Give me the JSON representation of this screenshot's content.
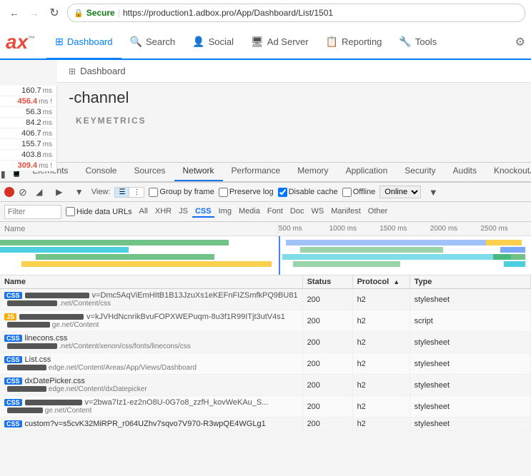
{
  "browser": {
    "url_secure": "Secure",
    "url": "https://production1.adbox.pro/App/Dashboard/List/1501",
    "back_disabled": false,
    "forward_disabled": true
  },
  "nav": {
    "logo": "ax",
    "logo_sup": "™",
    "items": [
      {
        "id": "dashboard",
        "label": "Dashboard",
        "icon": "⊞",
        "active": true
      },
      {
        "id": "search",
        "label": "Search",
        "icon": "🔍"
      },
      {
        "id": "social",
        "label": "Social",
        "icon": "👤"
      },
      {
        "id": "adserver",
        "label": "Ad Server",
        "icon": "🖥"
      },
      {
        "id": "reporting",
        "label": "Reporting",
        "icon": "📋"
      },
      {
        "id": "tools",
        "label": "Tools",
        "icon": "🔧"
      }
    ],
    "settings_icon": "⚙"
  },
  "breadcrumb": {
    "icon": "⊞",
    "text": "Dashboard"
  },
  "page": {
    "title": "-channel",
    "subtitle": "KEYMETRICS"
  },
  "metrics": [
    {
      "value": "160.7",
      "unit": "ms",
      "alert": false
    },
    {
      "value": "456.4",
      "unit": "ms !",
      "alert": true
    },
    {
      "value": "56.3",
      "unit": "ms",
      "alert": false
    },
    {
      "value": "84.2",
      "unit": "ms",
      "alert": false
    },
    {
      "value": "406.7",
      "unit": "ms",
      "alert": false
    },
    {
      "value": "155.7",
      "unit": "ms",
      "alert": false
    },
    {
      "value": "403.8",
      "unit": "ms",
      "alert": false
    },
    {
      "value": "309.4",
      "unit": "ms !",
      "alert": true
    }
  ],
  "devtools": {
    "tabs": [
      {
        "id": "elements",
        "label": "Elements"
      },
      {
        "id": "console",
        "label": "Console"
      },
      {
        "id": "sources",
        "label": "Sources"
      },
      {
        "id": "network",
        "label": "Network",
        "active": true
      },
      {
        "id": "performance",
        "label": "Performance"
      },
      {
        "id": "memory",
        "label": "Memory"
      },
      {
        "id": "application",
        "label": "Application"
      },
      {
        "id": "security",
        "label": "Security"
      },
      {
        "id": "audits",
        "label": "Audits"
      },
      {
        "id": "knockoutjs",
        "label": "KnockoutJS"
      }
    ],
    "network": {
      "view_label": "View:",
      "group_by_frame": "Group by frame",
      "preserve_log": "Preserve log",
      "disable_cache": "Disable cache",
      "offline": "Offline",
      "online_label": "Online",
      "filter_placeholder": "Filter",
      "hide_data_urls": "Hide data URLs",
      "filter_types": [
        "All",
        "XHR",
        "JS",
        "CSS",
        "Img",
        "Media",
        "Font",
        "Doc",
        "WS",
        "Manifest",
        "Other"
      ],
      "active_filter": "CSS",
      "timeline_ticks": [
        "500 ms",
        "1000 ms",
        "1500 ms",
        "2000 ms",
        "2500 ms"
      ],
      "columns": [
        {
          "id": "name",
          "label": "Name"
        },
        {
          "id": "status",
          "label": "Status"
        },
        {
          "id": "protocol",
          "label": "Protocol",
          "sort": "asc"
        },
        {
          "id": "type",
          "label": "Type"
        }
      ],
      "rows": [
        {
          "type": "css",
          "name_prefix": "v=Dmc5AqViEmHItB1B13JzuXs1eKEFnFIZSmfkPQ9BU81",
          "name_suffix": ".net/Content/css",
          "status": "200",
          "protocol": "h2",
          "filetype": "stylesheet"
        },
        {
          "type": "js",
          "name_prefix": "v=kJVHdNcnrikBvuFOPXWEPuqm-8u3f1R99ITjt3utV4s1",
          "name_suffix": "ge.net/Content",
          "status": "200",
          "protocol": "h2",
          "filetype": "script"
        },
        {
          "type": "css",
          "name_prefix": "linecons.css",
          "name_suffix": ".net/Content/xenon/css/fonts/linecons/css",
          "status": "200",
          "protocol": "h2",
          "filetype": "stylesheet"
        },
        {
          "type": "css",
          "name_prefix": "List.css",
          "name_suffix": "edge.net/Content/Areas/App/Views/Dashboard",
          "status": "200",
          "protocol": "h2",
          "filetype": "stylesheet"
        },
        {
          "type": "css",
          "name_prefix": "dxDatePicker.css",
          "name_suffix": "edge.net/Content/dxDatepicker",
          "status": "200",
          "protocol": "h2",
          "filetype": "stylesheet"
        },
        {
          "type": "css",
          "name_prefix": "v=2bwa7Iz1-ez2nO8U-0G7o8_zzfH_kovWeKAu_S...",
          "name_suffix": "ge.net/Content",
          "status": "200",
          "protocol": "h2",
          "filetype": "stylesheet"
        },
        {
          "type": "css",
          "name_prefix": "custom?v=s5cvK32MiRPR_r064UZhv7sqvo7V970-R3wpQE4WGLg1",
          "name_suffix": "",
          "status": "200",
          "protocol": "h2",
          "filetype": "stylesheet"
        }
      ]
    }
  },
  "colors": {
    "accent": "#0080ff",
    "alert": "#e74c3c",
    "bar_green": "#34a853",
    "bar_blue": "#4285f4",
    "bar_orange": "#fbbc04",
    "bar_teal": "#00bcd4"
  }
}
